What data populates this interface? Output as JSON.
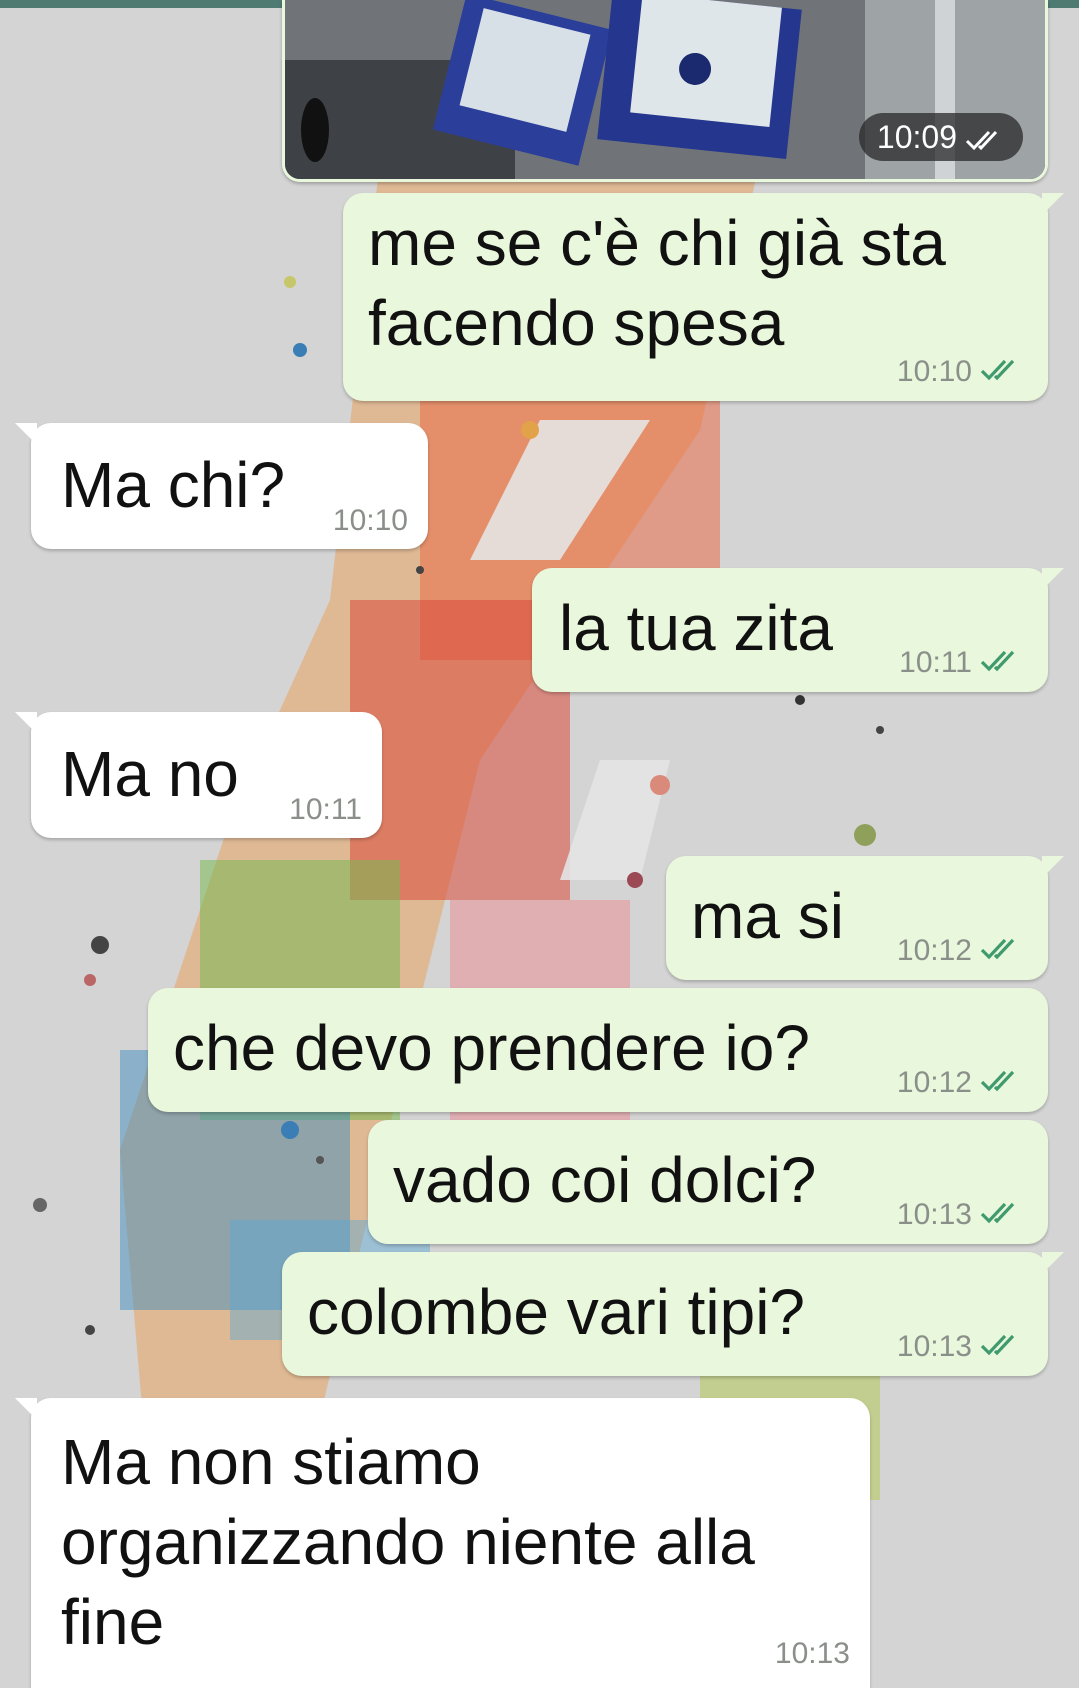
{
  "image_message": {
    "time": "10:09",
    "status_icon": "double-check-icon"
  },
  "messages": [
    {
      "direction": "outgoing",
      "text_lines": [
        "me se c'è chi già sta",
        "facendo spesa"
      ],
      "time": "10:10",
      "status_icon": "double-check-icon"
    },
    {
      "direction": "incoming",
      "text_lines": [
        "Ma chi?"
      ],
      "time": "10:10"
    },
    {
      "direction": "outgoing",
      "text_lines": [
        "la tua zita"
      ],
      "time": "10:11",
      "status_icon": "double-check-icon"
    },
    {
      "direction": "incoming",
      "text_lines": [
        "Ma no"
      ],
      "time": "10:11"
    },
    {
      "direction": "outgoing",
      "text_lines": [
        "ma si"
      ],
      "time": "10:12",
      "status_icon": "double-check-icon"
    },
    {
      "direction": "outgoing",
      "text_lines": [
        "che devo prendere io?"
      ],
      "time": "10:12",
      "status_icon": "double-check-icon"
    },
    {
      "direction": "outgoing",
      "text_lines": [
        "vado coi dolci?"
      ],
      "time": "10:13",
      "status_icon": "double-check-icon"
    },
    {
      "direction": "outgoing",
      "text_lines": [
        "colombe vari tipi?"
      ],
      "time": "10:13",
      "status_icon": "double-check-icon"
    },
    {
      "direction": "incoming",
      "text_lines": [
        "Ma non stiamo",
        "organizzando niente alla",
        "fine"
      ],
      "time": "10:13"
    }
  ],
  "colors": {
    "outgoing_bubble": "#e9f7dc",
    "incoming_bubble": "#ffffff",
    "read_ticks": "#3f9a6e",
    "background": "#d4d4d4"
  }
}
